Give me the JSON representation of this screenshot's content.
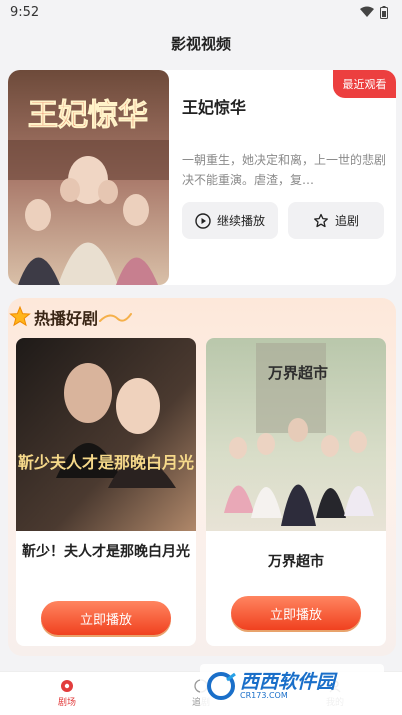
{
  "status_bar": {
    "time": "9:52"
  },
  "app": {
    "title": "影视视频"
  },
  "recent": {
    "badge": "最近观看",
    "title": "王妃惊华",
    "poster_text": "王妃惊华",
    "description": "一朝重生，她决定和离，上一世的悲剧决不能重演。虐渣，复…",
    "continue_label": "继续播放",
    "follow_label": "追剧"
  },
  "hot": {
    "title": "热播好剧",
    "items": [
      {
        "title": "靳少！夫人才是那晚白月光",
        "poster_text": "靳少夫人才是那晚白月光",
        "play_label": "立即播放"
      },
      {
        "title": "万界超市",
        "poster_text": "万界超市",
        "play_label": "立即播放"
      }
    ]
  },
  "nav": {
    "items": [
      {
        "label": "剧场"
      },
      {
        "label": "追剧"
      },
      {
        "label": "我的"
      }
    ]
  },
  "watermark": {
    "text": "西西软件园",
    "site": "CR173.COM"
  },
  "colors": {
    "accent": "#ec3f3f",
    "play_button": "#f0411f",
    "hot_bg": "#fde8da"
  }
}
